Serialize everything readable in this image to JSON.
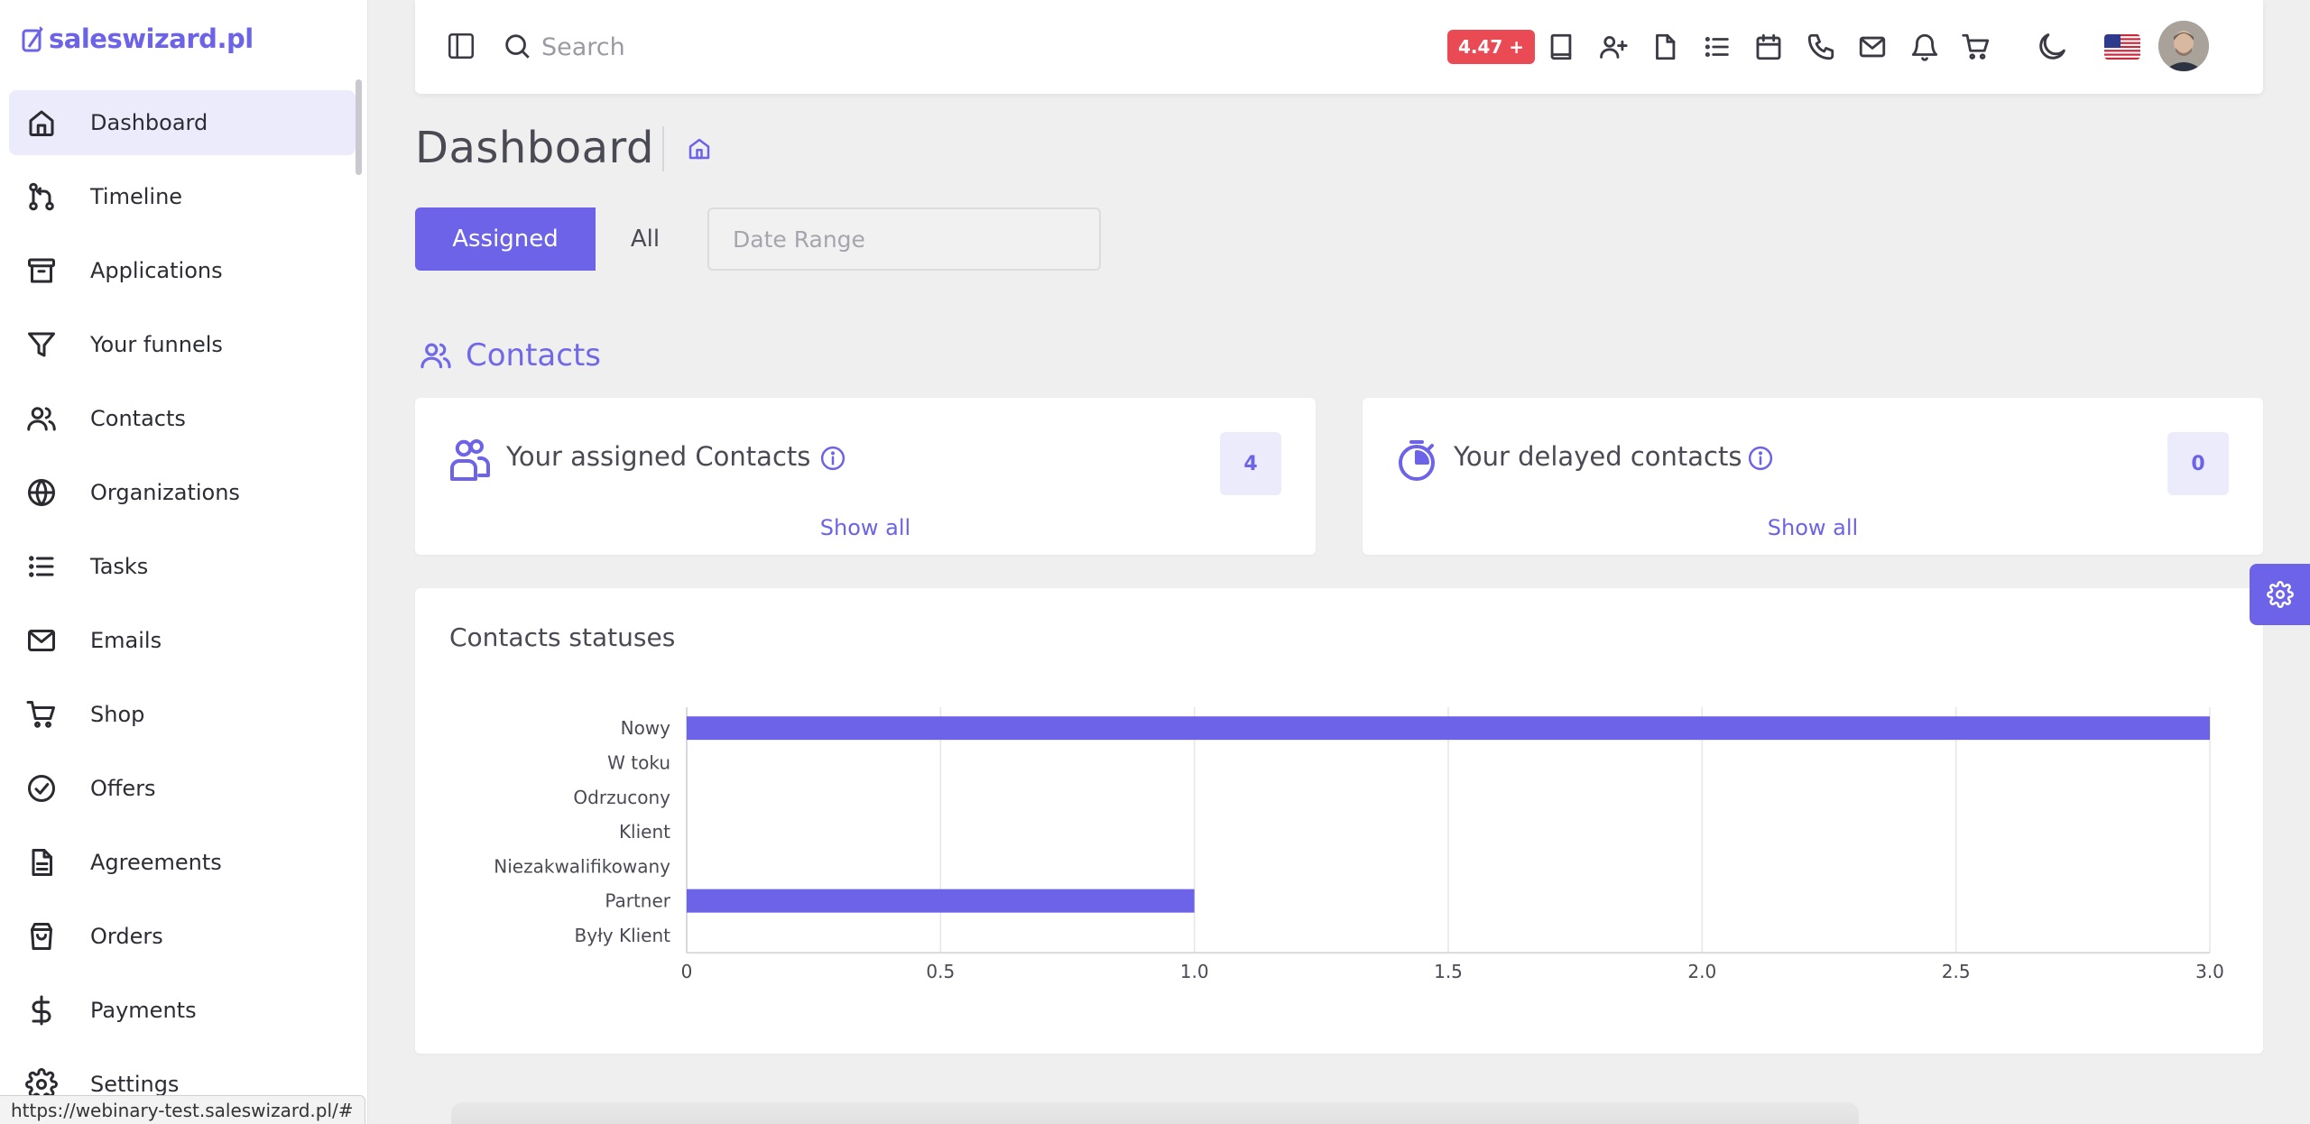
{
  "app": {
    "logo_text": "saleswizard.pl"
  },
  "sidebar": {
    "items": [
      {
        "label": "Dashboard",
        "icon": "home-icon",
        "active": true
      },
      {
        "label": "Timeline",
        "icon": "git-branch-icon"
      },
      {
        "label": "Applications",
        "icon": "archive-icon"
      },
      {
        "label": "Your funnels",
        "icon": "filter-icon"
      },
      {
        "label": "Contacts",
        "icon": "users-icon"
      },
      {
        "label": "Organizations",
        "icon": "globe-icon"
      },
      {
        "label": "Tasks",
        "icon": "list-icon"
      },
      {
        "label": "Emails",
        "icon": "mail-icon"
      },
      {
        "label": "Shop",
        "icon": "cart-icon"
      },
      {
        "label": "Offers",
        "icon": "check-circle-icon"
      },
      {
        "label": "Agreements",
        "icon": "document-icon"
      },
      {
        "label": "Orders",
        "icon": "shopping-bag-icon"
      },
      {
        "label": "Payments",
        "icon": "dollar-icon"
      },
      {
        "label": "Settings",
        "icon": "gear-icon"
      }
    ]
  },
  "status_url": "https://webinary-test.saleswizard.pl/#",
  "topbar": {
    "search_placeholder": "Search",
    "version_badge": "4.47 +",
    "icons": [
      "book-icon",
      "add-user-icon",
      "file-icon",
      "list-icon",
      "calendar-icon",
      "phone-icon",
      "mail-icon",
      "bell-icon",
      "cart-icon"
    ],
    "theme_icon": "moon-icon",
    "language_flag": "us-flag-icon"
  },
  "page": {
    "title": "Dashboard",
    "filter": {
      "assigned": "Assigned",
      "all": "All",
      "date_placeholder": "Date Range"
    },
    "section_title": "Contacts"
  },
  "cards": [
    {
      "title": "Your assigned Contacts",
      "count": "4",
      "link": "Show all",
      "icon": "users-outline-icon"
    },
    {
      "title": "Your delayed contacts",
      "count": "0",
      "link": "Show all",
      "icon": "stopwatch-icon"
    }
  ],
  "chart_title": "Contacts statuses",
  "colors": {
    "accent": "#6c63e8",
    "badge": "#e94a54"
  },
  "chart_data": {
    "type": "bar",
    "orientation": "horizontal",
    "title": "Contacts statuses",
    "categories": [
      "Nowy",
      "W toku",
      "Odrzucony",
      "Klient",
      "Niezakwalifikowany",
      "Partner",
      "Były Klient"
    ],
    "values": [
      3,
      0,
      0,
      0,
      0,
      1,
      0
    ],
    "xlim": [
      0,
      3
    ],
    "ticks": [
      "0",
      "0.5",
      "1.0",
      "1.5",
      "2.0",
      "2.5",
      "3.0"
    ],
    "tick_values": [
      0,
      0.5,
      1,
      1.5,
      2,
      2.5,
      3
    ],
    "grid": true,
    "color": "#6c63e8"
  }
}
